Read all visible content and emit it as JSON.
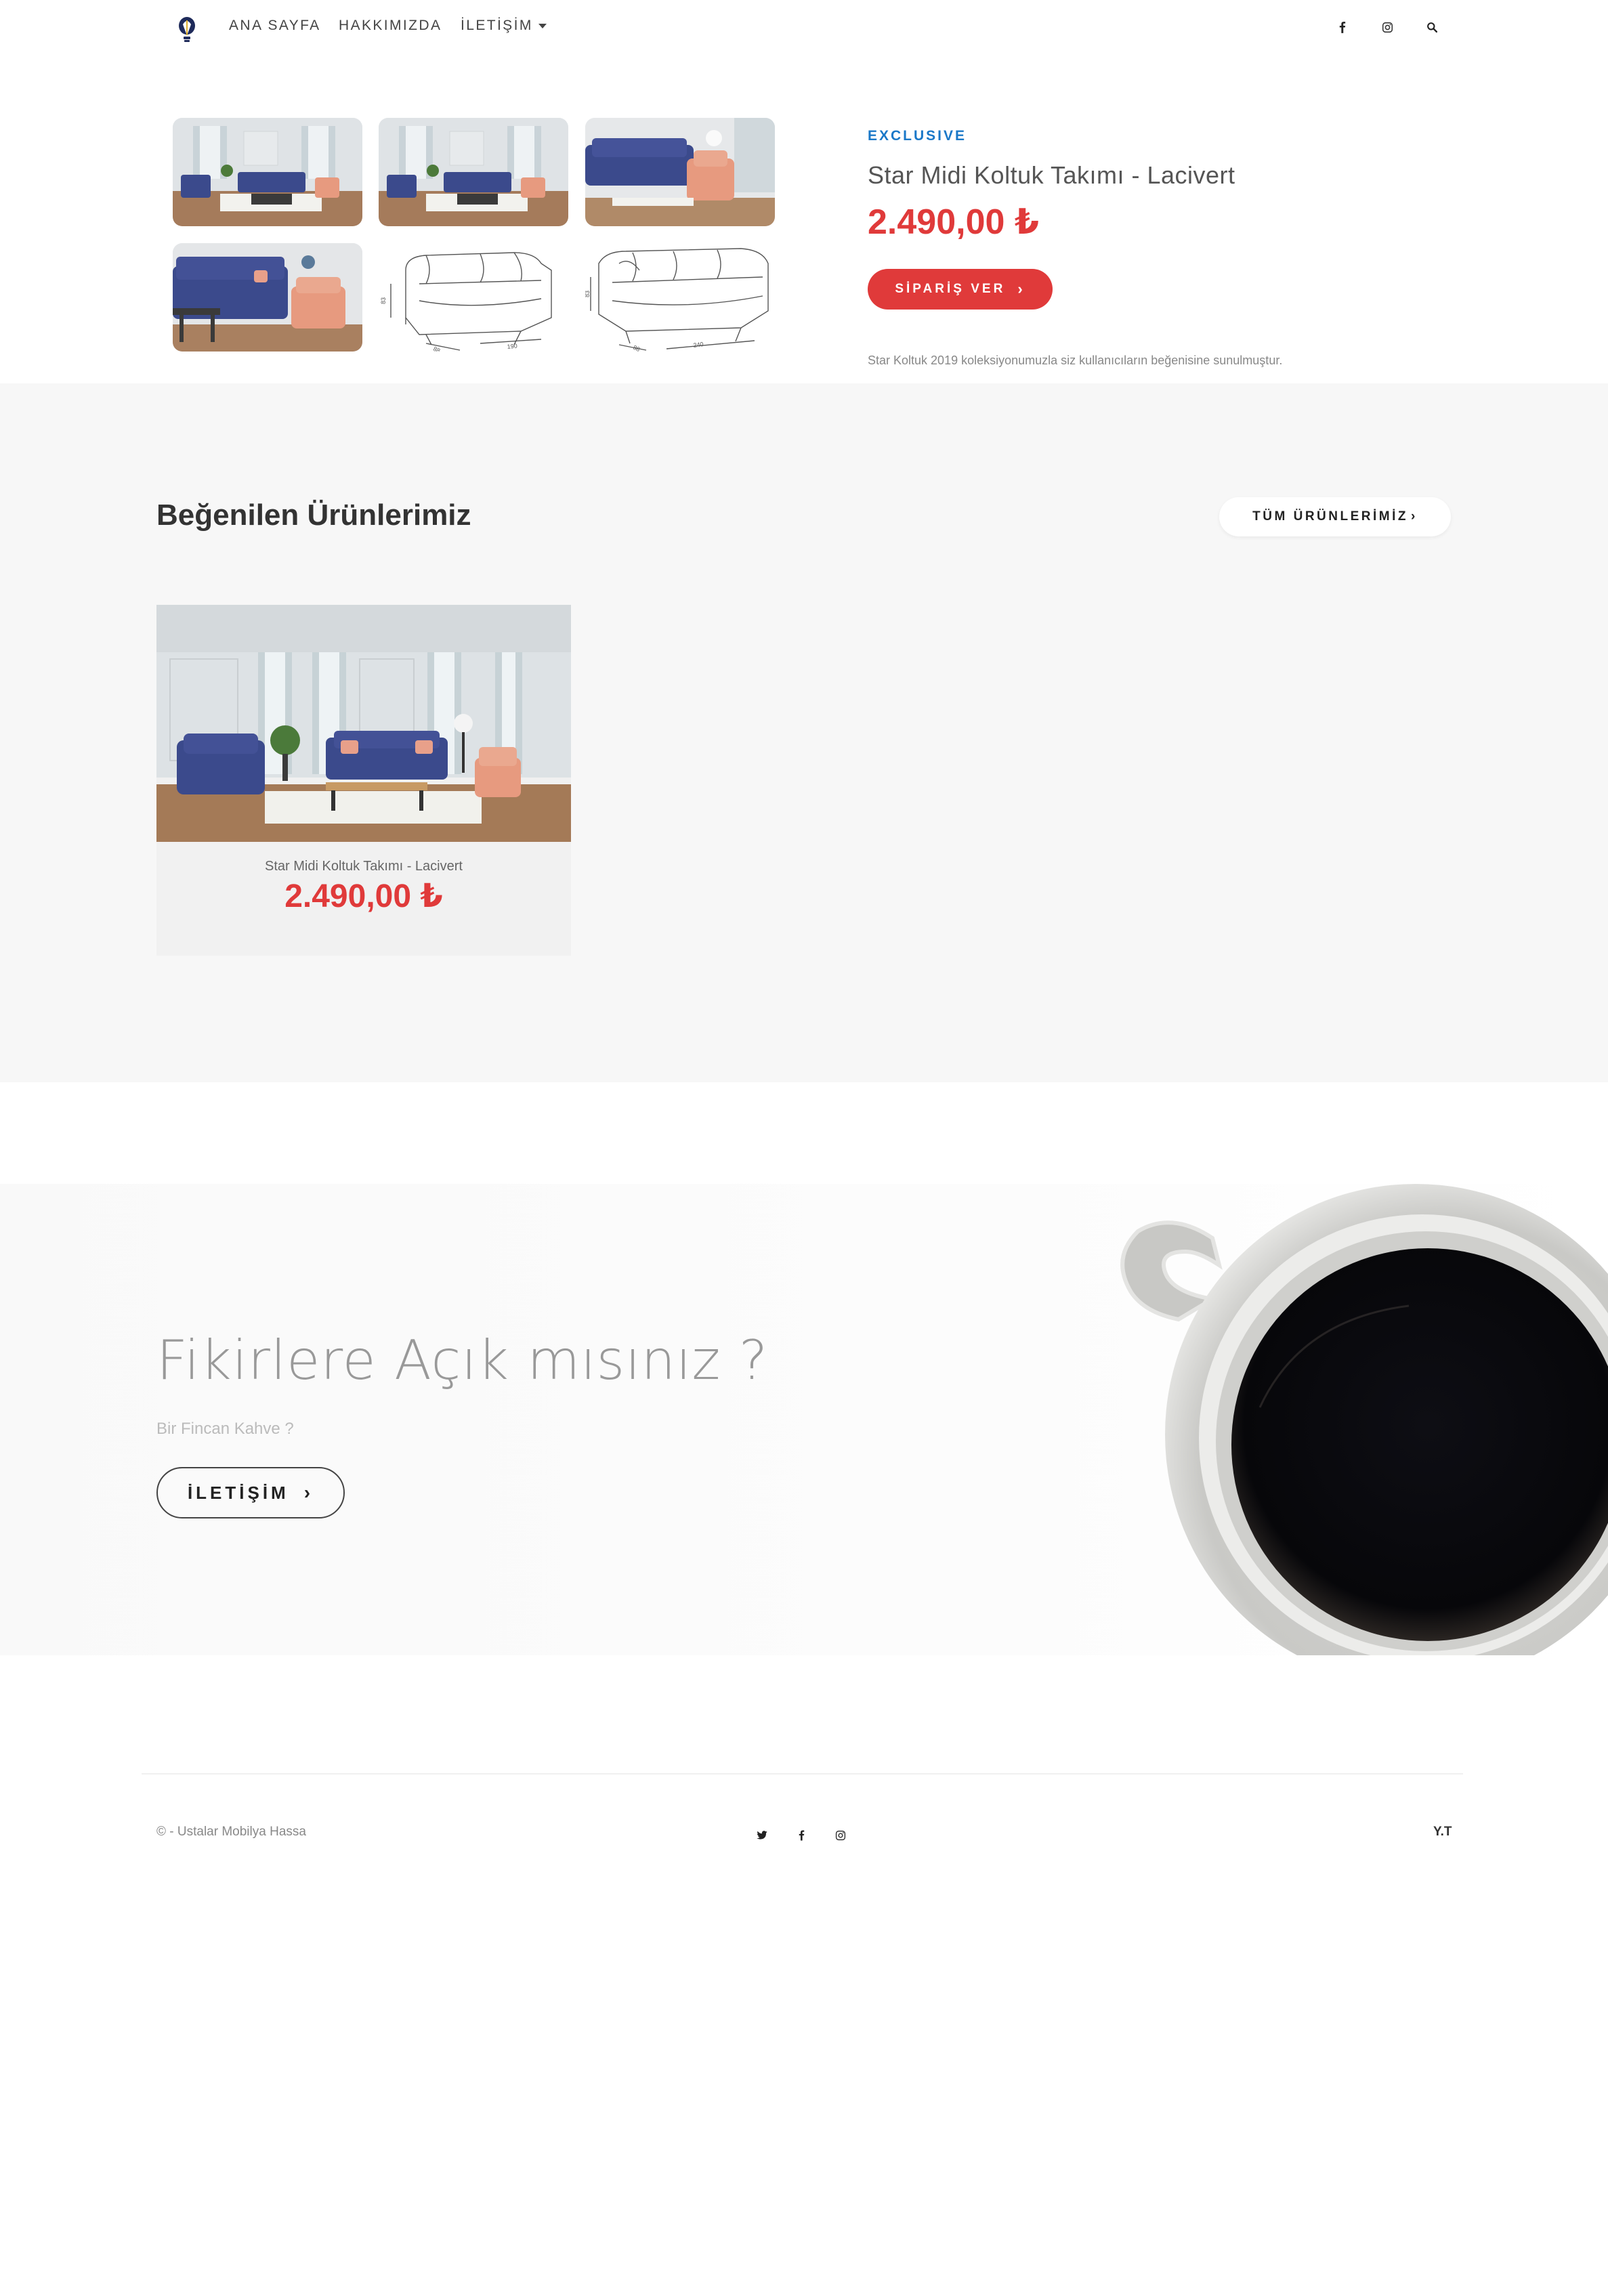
{
  "nav": {
    "items": [
      {
        "label": "ANA SAYFA"
      },
      {
        "label": "HAKKIMIZDA"
      },
      {
        "label": "İLETİŞİM"
      }
    ],
    "icons": [
      "facebook-icon",
      "instagram-icon",
      "search-icon"
    ]
  },
  "product": {
    "badge": "EXCLUSIVE",
    "title": "Star Midi Koltuk Takımı - Lacivert",
    "price": "2.490,00 ₺",
    "order_label": "SİPARİŞ VER",
    "description": "Star Koltuk 2019 koleksiyonumuzla siz kullanıcıların beğenisine sunulmuştur.",
    "gallery_count": 6,
    "colors": {
      "accent": "#e03a3a",
      "badge": "#1a78c8",
      "sofa": "#3b4a8c",
      "armchair": "#e79a7f"
    }
  },
  "popular": {
    "title": "Beğenilen Ürünlerimiz",
    "all_label": "TÜM ÜRÜNLERİMİZ",
    "products": [
      {
        "name": "Star Midi Koltuk Takımı - Lacivert",
        "price": "2.490,00 ₺"
      }
    ]
  },
  "banner": {
    "title": "Fikirlere Açık mısınız ?",
    "subtitle": "Bir Fincan Kahve ?",
    "button_label": "İLETİŞİM"
  },
  "footer": {
    "copyright": "© - Ustalar Mobilya Hassa",
    "right_text": "Y.T",
    "icons": [
      "twitter-icon",
      "facebook-icon",
      "instagram-icon"
    ]
  }
}
